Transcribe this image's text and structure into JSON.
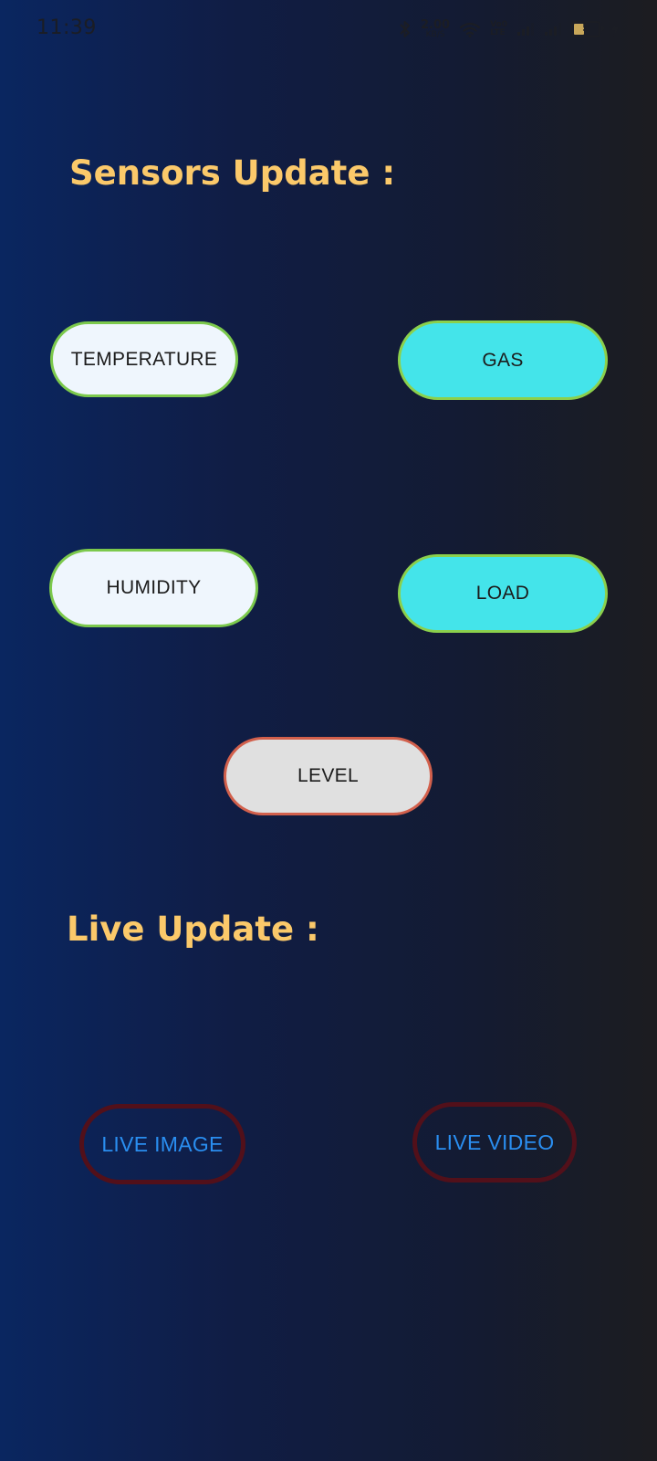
{
  "status_bar": {
    "time": "11:39",
    "network_speed_value": "2.00",
    "network_speed_unit": "KB/S",
    "volte_top": "Vo0",
    "volte_bottom": "LTE",
    "battery_level": "5",
    "icons": [
      "bluetooth-icon",
      "wifi-icon",
      "signal-icon",
      "signal-icon",
      "battery-icon",
      "charging-icon"
    ]
  },
  "sensors_section": {
    "title": "Sensors Update :",
    "buttons": {
      "temperature": "TEMPERATURE",
      "gas": "GAS",
      "humidity": "HUMIDITY",
      "load": "LOAD",
      "level": "LEVEL"
    }
  },
  "live_section": {
    "title": "Live Update :",
    "buttons": {
      "live_image": "LIVE IMAGE",
      "live_video": "LIVE VIDEO"
    }
  },
  "colors": {
    "heading": "#fbc96a",
    "cyan_button": "#44e4ea",
    "white_button": "#eff6fd",
    "grey_button": "#e0e0e0",
    "green_border": "#7cc94c",
    "red_border": "#d2604c",
    "live_button_border": "#52101a",
    "live_button_text": "#2a8ef0",
    "background_left": "#0a2660",
    "background_right": "#1c1c20"
  }
}
